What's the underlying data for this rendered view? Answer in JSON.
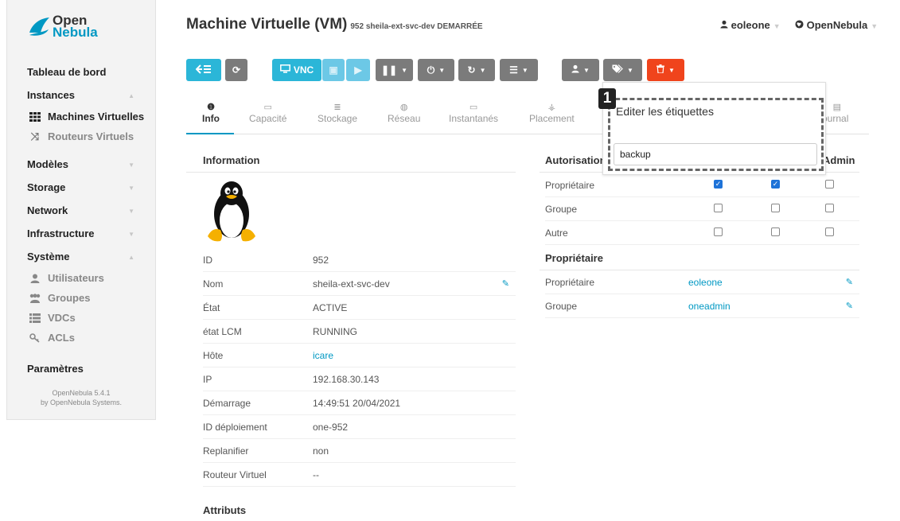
{
  "brand": {
    "line1": "Open",
    "line2": "Nebula"
  },
  "header": {
    "title": "Machine Virtuelle (VM)",
    "subtitle": "952 sheila-ext-svc-dev DEMARRÉE",
    "user": "eoleone",
    "zone": "OpenNebula"
  },
  "sidebar": {
    "dashboard": "Tableau de bord",
    "instances": "Instances",
    "vms": "Machines Virtuelles",
    "vrouters": "Routeurs Virtuels",
    "templates": "Modèles",
    "storage": "Storage",
    "network": "Network",
    "infrastructure": "Infrastructure",
    "system": "Système",
    "users": "Utilisateurs",
    "groups": "Groupes",
    "vdcs": "VDCs",
    "acls": "ACLs",
    "settings": "Paramètres",
    "version_line1": "OpenNebula 5.4.1",
    "version_line2": "by OpenNebula Systems."
  },
  "toolbar": {
    "vnc": "VNC"
  },
  "tabs": {
    "info": "Info",
    "capacity": "Capacité",
    "storage": "Stockage",
    "network": "Réseau",
    "snapshots": "Instantanés",
    "placement": "Placement",
    "log": "Journal"
  },
  "info": {
    "title": "Information",
    "rows": [
      {
        "k": "ID",
        "v": "952"
      },
      {
        "k": "Nom",
        "v": "sheila-ext-svc-dev"
      },
      {
        "k": "État",
        "v": "ACTIVE"
      },
      {
        "k": "état LCM",
        "v": "RUNNING"
      },
      {
        "k": "Hôte",
        "v": "icare"
      },
      {
        "k": "IP",
        "v": "192.168.30.143"
      },
      {
        "k": "Démarrage",
        "v": "14:49:51 20/04/2021"
      },
      {
        "k": "ID déploiement",
        "v": "one-952"
      },
      {
        "k": "Replanifier",
        "v": "non"
      },
      {
        "k": "Routeur Virtuel",
        "v": "--"
      }
    ],
    "attributes_title": "Attributs"
  },
  "permissions": {
    "title": "Autorisations",
    "admin_header": "Admin",
    "rows": [
      {
        "k": "Propriétaire",
        "use": true,
        "manage": true,
        "admin": false
      },
      {
        "k": "Groupe",
        "use": false,
        "manage": false,
        "admin": false
      },
      {
        "k": "Autre",
        "use": false,
        "manage": false,
        "admin": false
      }
    ]
  },
  "ownership": {
    "title": "Propriétaire",
    "owner_label": "Propriétaire",
    "owner": "eoleone",
    "group_label": "Groupe",
    "group": "oneadmin"
  },
  "popup": {
    "title": "Editer les étiquettes",
    "value": "backup",
    "badge": "1"
  }
}
